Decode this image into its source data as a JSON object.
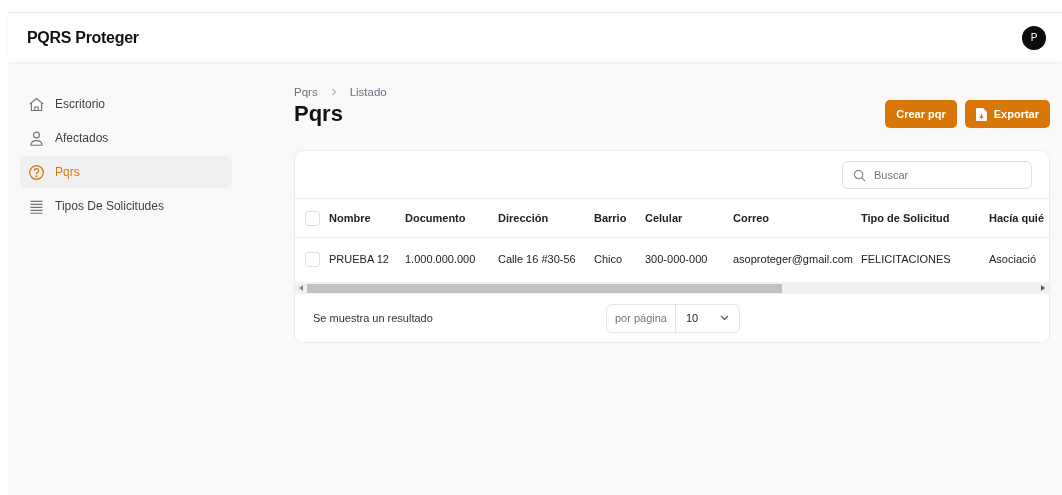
{
  "app_title": "PQRS Proteger",
  "avatar": "P",
  "sidebar": {
    "items": [
      {
        "label": "Escritorio",
        "selected": false
      },
      {
        "label": "Afectados",
        "selected": false
      },
      {
        "label": "Pqrs",
        "selected": true
      },
      {
        "label": "Tipos De Solicitudes",
        "selected": false
      }
    ]
  },
  "breadcrumb": [
    "Pqrs",
    "Listado"
  ],
  "page_title": "Pqrs",
  "actions": [
    "Crear pqr",
    "Exportar"
  ],
  "search": {
    "placeholder": "Buscar"
  },
  "table": {
    "columns": [
      "Nombre",
      "Documento",
      "Dirección",
      "Barrio",
      "Celular",
      "Correo",
      "Tipo de Solicitud",
      "Hacía quié"
    ],
    "rows": [
      {
        "checked": false,
        "cells": [
          "PRUEBA 12",
          "1.000.000.000",
          "Calle 16 #30-56",
          "Chico",
          "300-000-000",
          "asoproteger@gmail.com",
          "FELICITACIONES",
          "Asociació"
        ]
      }
    ],
    "header_checked": false
  },
  "footer": {
    "summary": "Se muestra un resultado",
    "per_page_label": "por página",
    "per_page": "10"
  }
}
